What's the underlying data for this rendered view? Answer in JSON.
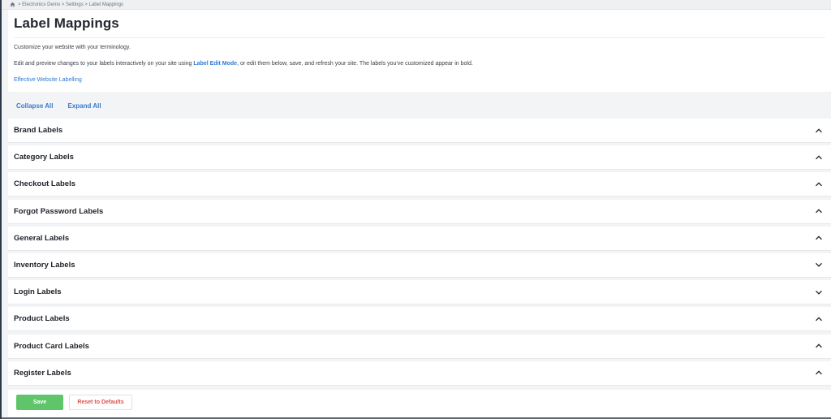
{
  "breadcrumb": {
    "text": "> Electronics Demo > Settings > Label Mappings"
  },
  "header": {
    "title": "Label Mappings",
    "intro": "Customize your website with your terminology.",
    "desc_before": "Edit and preview changes to your labels interactively on your site using ",
    "desc_link": "Label Edit Mode",
    "desc_after": ", or edit them below, save, and refresh your site. The labels you've customized appear in bold.",
    "effective_link": "Effective Website Labelling"
  },
  "controls": {
    "collapse_all": "Collapse All",
    "expand_all": "Expand All"
  },
  "sections": [
    {
      "title": "Brand Labels",
      "state": "expanded"
    },
    {
      "title": "Category Labels",
      "state": "expanded"
    },
    {
      "title": "Checkout Labels",
      "state": "expanded"
    },
    {
      "title": "Forgot Password Labels",
      "state": "expanded"
    },
    {
      "title": "General Labels",
      "state": "expanded"
    },
    {
      "title": "Inventory Labels",
      "state": "collapsed"
    },
    {
      "title": "Login Labels",
      "state": "collapsed"
    },
    {
      "title": "Product Labels",
      "state": "expanded"
    },
    {
      "title": "Product Card Labels",
      "state": "expanded"
    },
    {
      "title": "Register Labels",
      "state": "expanded"
    }
  ],
  "footer": {
    "save_label": "Save",
    "reset_label": "Reset to Defaults"
  },
  "colors": {
    "accent_link": "#2b7bd6",
    "save_green": "#5fc46a",
    "reset_red": "#d9534f"
  }
}
